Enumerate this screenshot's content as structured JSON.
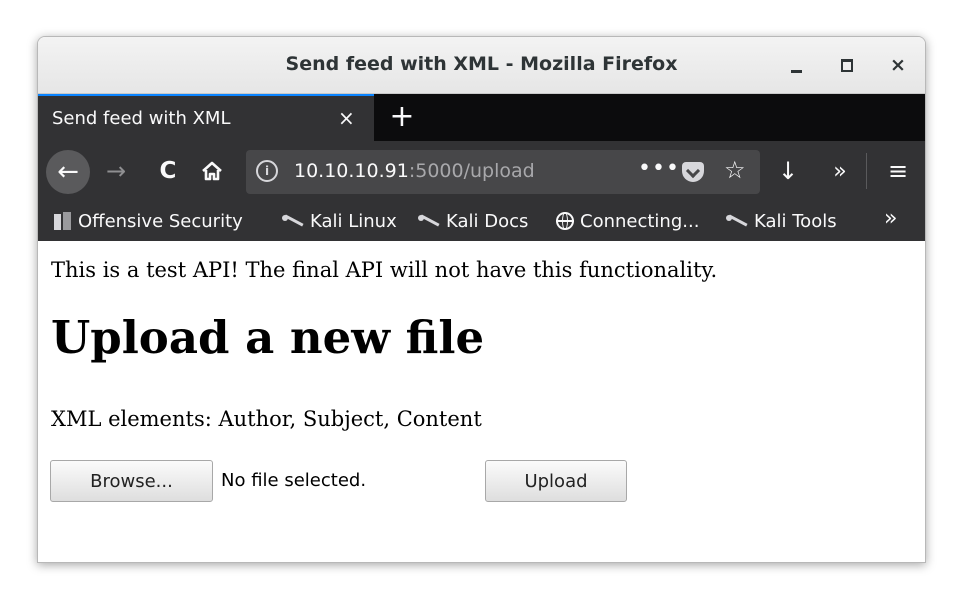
{
  "window": {
    "title": "Send feed with XML - Mozilla Firefox",
    "minimize": "_",
    "maximize": "□",
    "close": "×"
  },
  "tabs": [
    {
      "title": "Send feed with XML",
      "close": "×"
    }
  ],
  "new_tab": "+",
  "toolbar": {
    "back": "←",
    "forward": "→",
    "reload": "C",
    "url_host": "10.10.10.91",
    "url_rest": ":5000/upload",
    "more": "•••",
    "bookmark_star": "☆",
    "download": "↓",
    "overflow": "»",
    "menu": "≡"
  },
  "bookmarks": [
    {
      "label": "Offensive Security",
      "icon": "offensive-security-icon"
    },
    {
      "label": "Kali Linux",
      "icon": "kali-dragon-icon"
    },
    {
      "label": "Kali Docs",
      "icon": "kali-dragon-icon"
    },
    {
      "label": "Connecting...",
      "icon": "globe-icon"
    },
    {
      "label": "Kali Tools",
      "icon": "kali-dragon-icon"
    }
  ],
  "bookmarks_more": "»",
  "page": {
    "intro": "This is a test API! The final API will not have this functionality.",
    "heading": "Upload a new file",
    "elements": "XML elements: Author, Subject, Content",
    "browse_label": "Browse...",
    "no_file": "No file selected.",
    "upload_label": "Upload"
  },
  "colors": {
    "accent": "#0a84ff",
    "toolbar_bg": "#323234",
    "tabstrip_bg": "#0c0c0d",
    "urlbar_bg": "#474749"
  }
}
